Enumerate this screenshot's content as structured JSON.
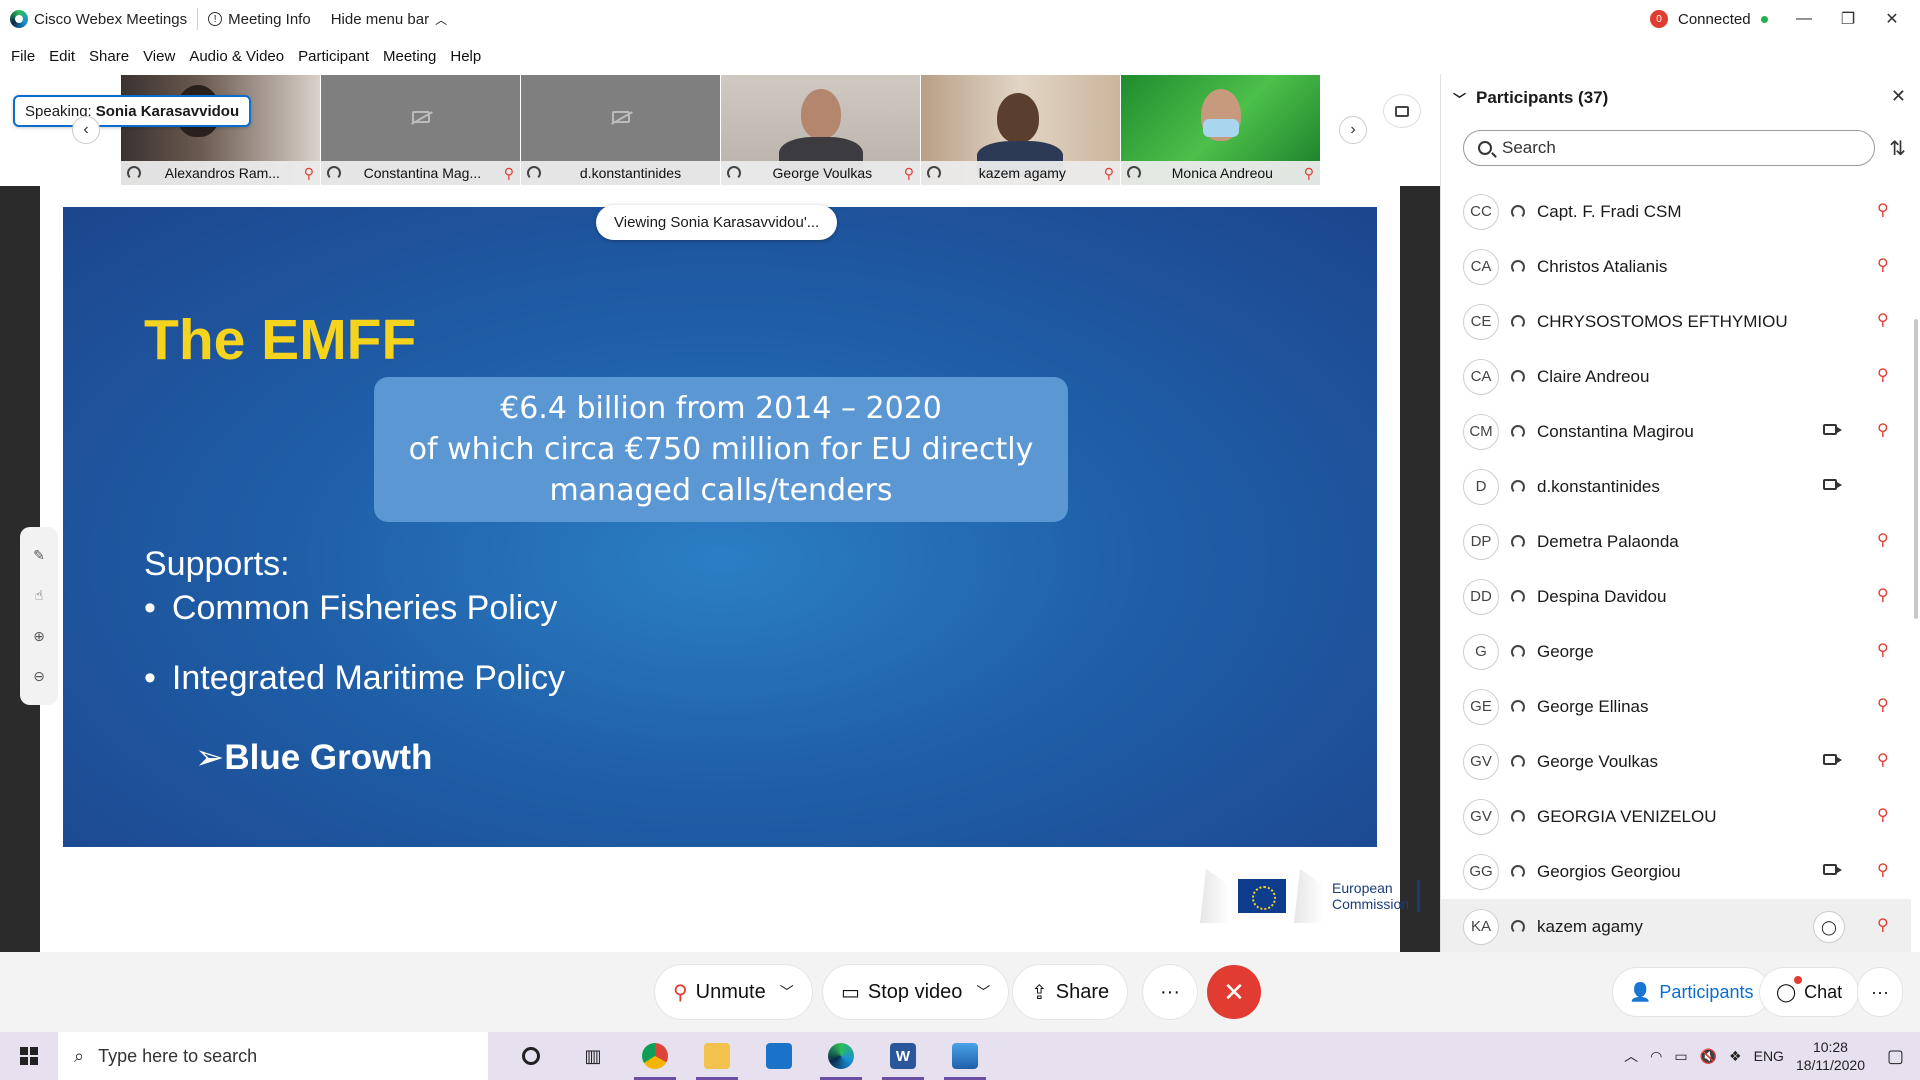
{
  "titlebar": {
    "app_name": "Cisco Webex Meetings",
    "meeting_info": "Meeting Info",
    "hide_menu": "Hide menu bar",
    "status_count": "0",
    "connection": "Connected"
  },
  "menu": [
    "File",
    "Edit",
    "Share",
    "View",
    "Audio & Video",
    "Participant",
    "Meeting",
    "Help"
  ],
  "speaking": {
    "prefix": "Speaking:",
    "name": "Sonia Karasavvidou"
  },
  "filmstrip": [
    {
      "name": "Alexandros Ram...",
      "muted": true,
      "video": true
    },
    {
      "name": "Constantina Mag...",
      "muted": true,
      "video": false
    },
    {
      "name": "d.konstantinides",
      "muted": false,
      "video": false
    },
    {
      "name": "George Voulkas",
      "muted": true,
      "video": true
    },
    {
      "name": "kazem agamy",
      "muted": true,
      "video": true
    },
    {
      "name": "Monica Andreou",
      "muted": true,
      "video": true
    }
  ],
  "viewing": "Viewing Sonia Karasavvidou'...",
  "slide": {
    "title": "The EMFF",
    "callout": [
      "€6.4 billion from 2014 – 2020",
      "of which circa €750 million for EU directly",
      "managed calls/tenders"
    ],
    "supports": "Supports:",
    "bullets": [
      "Common Fisheries Policy",
      "Integrated Maritime Policy"
    ],
    "sub_bullet": "Blue Growth",
    "logo_line1": "European",
    "logo_line2": "Commission"
  },
  "panel": {
    "title": "Participants (37)",
    "search_placeholder": "Search",
    "participants": [
      {
        "initials": "CC",
        "name": "Capt. F. Fradi CSM",
        "video": false,
        "muted": true
      },
      {
        "initials": "CA",
        "name": "Christos Atalianis",
        "video": false,
        "muted": true
      },
      {
        "initials": "CE",
        "name": "CHRYSOSTOMOS EFTHYMIOU",
        "video": false,
        "muted": true
      },
      {
        "initials": "CA",
        "name": "Claire Andreou",
        "video": false,
        "muted": true
      },
      {
        "initials": "CM",
        "name": "Constantina Magirou",
        "video": true,
        "muted": true
      },
      {
        "initials": "D",
        "name": "d.konstantinides",
        "video": true,
        "muted": false
      },
      {
        "initials": "DP",
        "name": "Demetra Palaonda",
        "video": false,
        "muted": true
      },
      {
        "initials": "DD",
        "name": "Despina Davidou",
        "video": false,
        "muted": true
      },
      {
        "initials": "G",
        "name": "George",
        "video": false,
        "muted": true
      },
      {
        "initials": "GE",
        "name": "George Ellinas",
        "video": false,
        "muted": true
      },
      {
        "initials": "GV",
        "name": "George Voulkas",
        "video": true,
        "muted": true
      },
      {
        "initials": "GV",
        "name": "GEORGIA VENIZELOU",
        "video": false,
        "muted": true
      },
      {
        "initials": "GG",
        "name": "Georgios Georgiou",
        "video": true,
        "muted": true
      },
      {
        "initials": "KA",
        "name": "kazem agamy",
        "video": false,
        "muted": true,
        "chat": true
      }
    ]
  },
  "controls": {
    "unmute": "Unmute",
    "stop_video": "Stop video",
    "share": "Share",
    "more": "···",
    "participants": "Participants",
    "chat": "Chat"
  },
  "taskbar": {
    "search_placeholder": "Type here to search",
    "language": "ENG",
    "time": "10:28",
    "date": "18/11/2020"
  },
  "colors": {
    "slide_title": "#f6d41d",
    "slide_bg": "#1f5fa8",
    "callout_bg": "#5b97d3",
    "accent": "#0a6ed1",
    "end_call": "#e03c31"
  }
}
